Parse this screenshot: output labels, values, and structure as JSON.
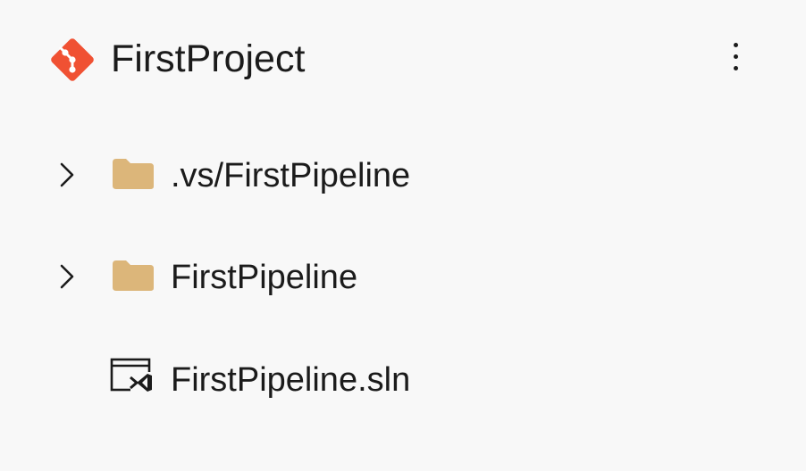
{
  "header": {
    "repo_name": "FirstProject",
    "repo_icon": "git-icon",
    "more_icon": "more-vertical-icon",
    "accent_color": "#f05133"
  },
  "tree": {
    "items": [
      {
        "label": ".vs/FirstPipeline",
        "type": "folder",
        "expandable": true,
        "icon": "folder-icon"
      },
      {
        "label": "FirstPipeline",
        "type": "folder",
        "expandable": true,
        "icon": "folder-icon"
      },
      {
        "label": "FirstPipeline.sln",
        "type": "solution-file",
        "expandable": false,
        "icon": "visual-studio-solution-icon"
      }
    ],
    "folder_color": "#dcb67a"
  }
}
